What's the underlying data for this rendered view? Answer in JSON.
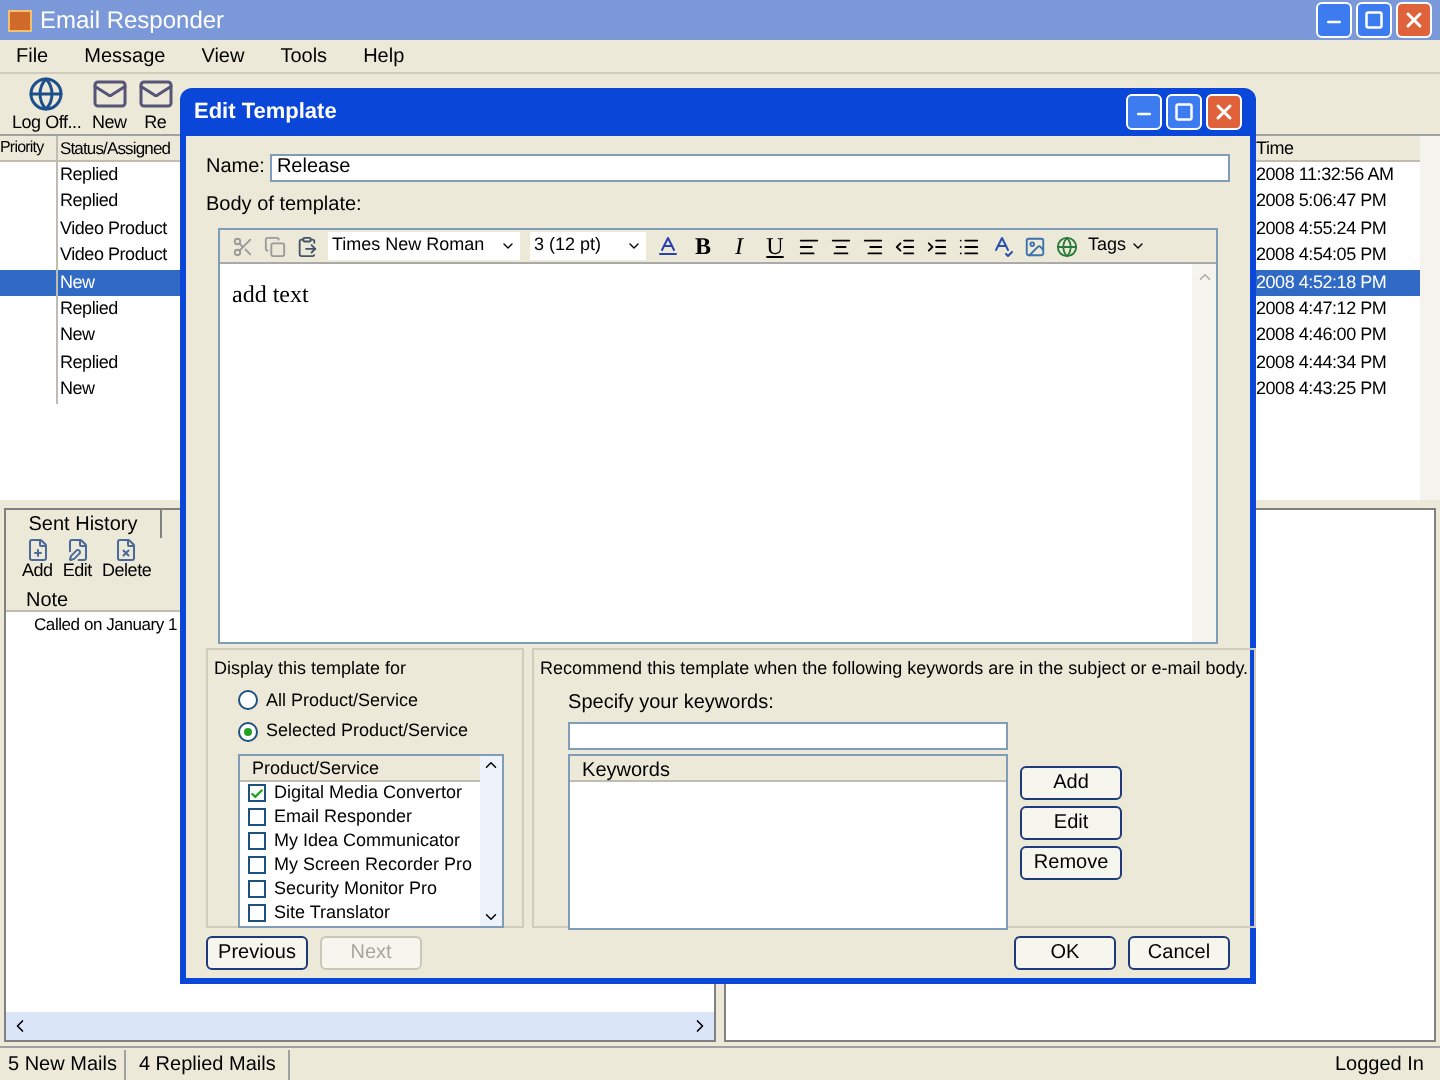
{
  "window": {
    "title": "Email Responder"
  },
  "menu": [
    "File",
    "Message",
    "View",
    "Tools",
    "Help"
  ],
  "toolbar": [
    "Log Off...",
    "New",
    "Re"
  ],
  "message_list": {
    "columns": [
      "Priority",
      "Status/Assigned",
      "Time"
    ],
    "rows": [
      {
        "status": "Replied",
        "time": "2008 11:32:56 AM",
        "selected": false
      },
      {
        "status": "Replied",
        "time": "2008 5:06:47 PM",
        "selected": false
      },
      {
        "status": "Video Product",
        "time": "2008 4:55:24 PM",
        "selected": false
      },
      {
        "status": "Video Product",
        "time": "2008 4:54:05 PM",
        "selected": false
      },
      {
        "status": "New",
        "time": "2008 4:52:18 PM",
        "selected": true
      },
      {
        "status": "Replied",
        "time": "2008 4:47:12 PM",
        "selected": false
      },
      {
        "status": "New",
        "time": "2008 4:46:00 PM",
        "selected": false
      },
      {
        "status": "Replied",
        "time": "2008 4:44:34 PM",
        "selected": false
      },
      {
        "status": "New",
        "time": "2008 4:43:25 PM",
        "selected": false
      }
    ]
  },
  "history": {
    "tab": "Sent History",
    "actions": [
      "Add",
      "Edit",
      "Delete"
    ],
    "column": "Note",
    "rows": [
      "Called on January 1"
    ]
  },
  "status_bar": [
    "5 New Mails",
    "4 Replied Mails",
    "Logged In"
  ],
  "dialog": {
    "title": "Edit Template",
    "name_label": "Name:",
    "name_value": "Release",
    "body_label": "Body of template:",
    "editor_toolbar": {
      "font": "Times New Roman",
      "size": "3 (12 pt)",
      "format_buttons": [
        "B",
        "I",
        "U"
      ],
      "tags": "Tags"
    },
    "body_text": "add text",
    "display_label": "Display this template for",
    "options": [
      {
        "label": "All Product/Service",
        "selected": false
      },
      {
        "label": "Selected Product/Service",
        "selected": true
      }
    ],
    "products_column": "Product/Service",
    "products": [
      {
        "label": "Digital Media Convertor",
        "checked": true
      },
      {
        "label": "Email Responder",
        "checked": false
      },
      {
        "label": "My Idea Communicator",
        "checked": false
      },
      {
        "label": "My Screen Recorder Pro",
        "checked": false
      },
      {
        "label": "Security Monitor Pro",
        "checked": false
      },
      {
        "label": "Site Translator",
        "checked": false
      }
    ],
    "recommend_text": "Recommend this template when the following keywords are in the subject or e-mail body.",
    "keywords_label": "Specify your keywords:",
    "keywords_column": "Keywords",
    "keyword_buttons": [
      "Add",
      "Edit",
      "Remove"
    ],
    "nav_buttons": [
      {
        "label": "Previous",
        "disabled": false
      },
      {
        "label": "Next",
        "disabled": true
      }
    ],
    "footer_buttons": [
      "OK",
      "Cancel"
    ]
  }
}
